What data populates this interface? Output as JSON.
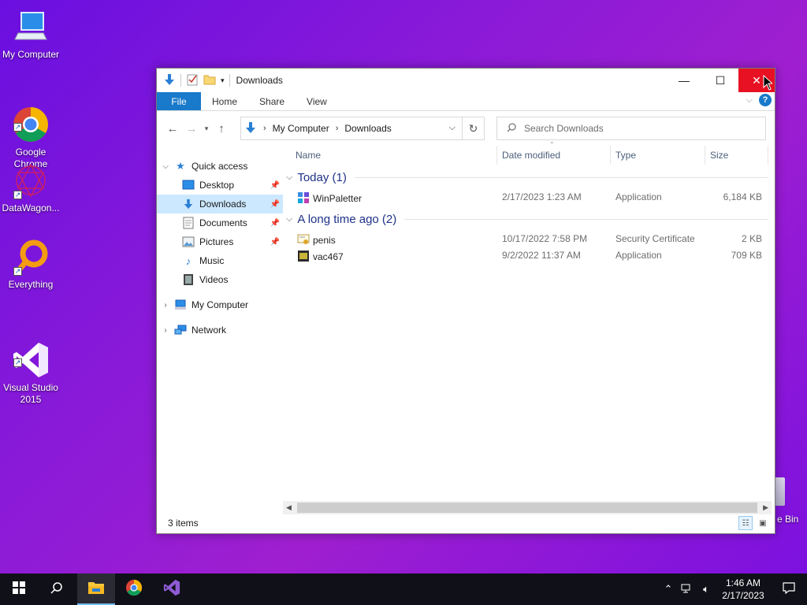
{
  "desktop": {
    "icons": [
      {
        "label": "My Computer",
        "icon": "computer-icon"
      },
      {
        "label": "Google\nChrome",
        "icon": "chrome-icon"
      },
      {
        "label": "DataWagon...",
        "icon": "datawagon-icon"
      },
      {
        "label": "Everything",
        "icon": "everything-search-icon"
      },
      {
        "label": "Visual Studio\n2015",
        "icon": "visual-studio-icon"
      }
    ],
    "recycle_label": "e Bin"
  },
  "window": {
    "title": "Downloads",
    "ribbon_tabs": [
      "File",
      "Home",
      "Share",
      "View"
    ],
    "address": {
      "root": "My Computer",
      "current": "Downloads"
    },
    "search_placeholder": "Search Downloads",
    "columns": [
      "Name",
      "Date modified",
      "Type",
      "Size"
    ],
    "groups": [
      {
        "label": "Today (1)",
        "files": [
          {
            "name": "WinPaletter",
            "date": "2/17/2023 1:23 AM",
            "type": "Application",
            "size": "6,184 KB",
            "icon": "winpaletter-icon"
          }
        ]
      },
      {
        "label": "A long time ago (2)",
        "files": [
          {
            "name": "penis",
            "date": "10/17/2022 7:58 PM",
            "type": "Security Certificate",
            "size": "2 KB",
            "icon": "certificate-icon"
          },
          {
            "name": "vac467",
            "date": "9/2/2022 11:37 AM",
            "type": "Application",
            "size": "709 KB",
            "icon": "app-icon"
          }
        ]
      }
    ],
    "status": "3 items"
  },
  "sidebar": {
    "quick_access": "Quick access",
    "items": [
      {
        "label": "Desktop",
        "icon": "desktop-folder-icon",
        "pinned": true
      },
      {
        "label": "Downloads",
        "icon": "downloads-icon",
        "pinned": true,
        "selected": true
      },
      {
        "label": "Documents",
        "icon": "documents-icon",
        "pinned": true
      },
      {
        "label": "Pictures",
        "icon": "pictures-icon",
        "pinned": true
      },
      {
        "label": "Music",
        "icon": "music-icon",
        "pinned": false
      },
      {
        "label": "Videos",
        "icon": "videos-icon",
        "pinned": false
      }
    ],
    "my_computer": "My Computer",
    "network": "Network"
  },
  "taskbar": {
    "time": "1:46 AM",
    "date": "2/17/2023",
    "pinned": [
      "start-icon",
      "search-icon",
      "file-explorer-icon",
      "chrome-icon",
      "visual-studio-icon"
    ]
  },
  "colors": {
    "accent": "#1979ca",
    "close": "#e81123",
    "selection": "#cce8ff",
    "group_header": "#1e3287"
  }
}
